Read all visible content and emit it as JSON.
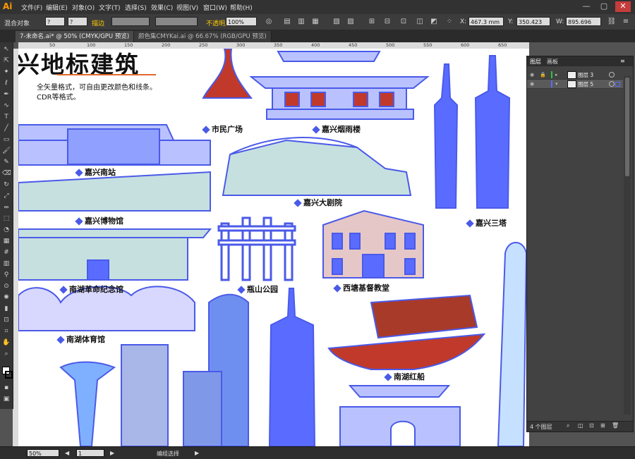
{
  "app": {
    "logo": "Ai"
  },
  "menu": [
    "文件(F)",
    "编辑(E)",
    "对象(O)",
    "文字(T)",
    "选择(S)",
    "效果(C)",
    "视图(V)",
    "窗口(W)",
    "帮助(H)"
  ],
  "window_buttons": [
    "—",
    "▢",
    "✕"
  ],
  "control_bar": {
    "object_label": "混合对象",
    "stroke_label": "描边",
    "opacity_label": "不透明度",
    "opacity_value": "100%",
    "x_value": "467.3 mm",
    "y_value": "350.423",
    "w_value": "895.696"
  },
  "tabs": [
    {
      "label": "7-未命名.ai* @ 50% (CMYK/GPU 预览)",
      "active": true
    },
    {
      "label": "颜色集CMYKai.ai @ 66.67% (RGB/GPU 预览)",
      "active": false
    }
  ],
  "ruler_ticks": [
    "50",
    "100",
    "150",
    "200",
    "250",
    "300",
    "350",
    "400",
    "450",
    "500",
    "550",
    "600",
    "650",
    "700"
  ],
  "artboard": {
    "title": "嘉兴地标建筑",
    "subtitle1": "全矢量格式，可自由更改颜色和线条。",
    "subtitle2": "CDR等格式。",
    "landmarks": [
      "市民广场",
      "嘉兴烟雨楼",
      "嘉兴南站",
      "嘉兴大剧院",
      "嘉兴博物馆",
      "嘉兴三塔",
      "南湖革命纪念馆",
      "瓶山公园",
      "西塘基督教堂",
      "南湖体育馆",
      "南湖红船"
    ]
  },
  "layers_panel": {
    "tabs": [
      "图层",
      "画板"
    ],
    "rows": [
      {
        "name": "图层 3",
        "selected": false
      },
      {
        "name": "图层 5",
        "selected": true
      }
    ],
    "footer_count": "4 个图层"
  },
  "status": {
    "zoom": "50%",
    "page": "1",
    "mode": "编组选择"
  },
  "colors": {
    "accent_blue": "#4a5ae8",
    "red": "#c0392b",
    "panel_bg": "#424242"
  }
}
